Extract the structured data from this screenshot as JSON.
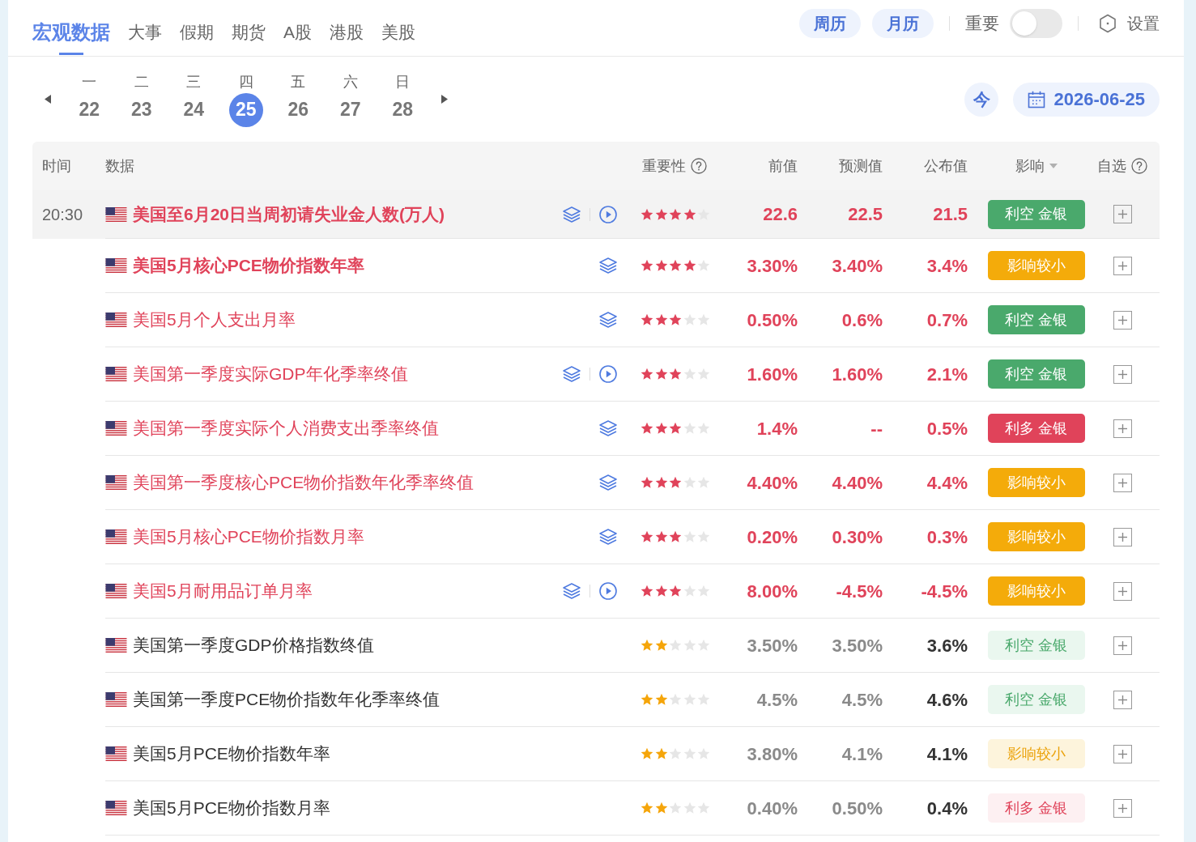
{
  "nav": {
    "tabs": [
      {
        "label": "宏观数据",
        "selected": true
      },
      {
        "label": "大事",
        "selected": false
      },
      {
        "label": "假期",
        "selected": false
      },
      {
        "label": "期货",
        "selected": false
      },
      {
        "label": "A股",
        "selected": false
      },
      {
        "label": "港股",
        "selected": false
      },
      {
        "label": "美股",
        "selected": false
      }
    ],
    "view_buttons": [
      "周历",
      "月历"
    ],
    "toggle": {
      "label": "重要",
      "on": false
    },
    "settings": "设置"
  },
  "week": {
    "days": [
      {
        "weekday": "一",
        "date": "22",
        "selected": false
      },
      {
        "weekday": "二",
        "date": "23",
        "selected": false
      },
      {
        "weekday": "三",
        "date": "24",
        "selected": false
      },
      {
        "weekday": "四",
        "date": "25",
        "selected": true
      },
      {
        "weekday": "五",
        "date": "26",
        "selected": false
      },
      {
        "weekday": "六",
        "date": "27",
        "selected": false
      },
      {
        "weekday": "日",
        "date": "28",
        "selected": false
      }
    ],
    "today_button": "今",
    "date_button": "2026-06-25"
  },
  "table": {
    "columns": [
      {
        "label": "时间",
        "kind": "plain"
      },
      {
        "label": "数据",
        "kind": "plain"
      },
      {
        "label": "重要性",
        "kind": "help"
      },
      {
        "label": "前值",
        "kind": "plain"
      },
      {
        "label": "预测值",
        "kind": "plain"
      },
      {
        "label": "公布值",
        "kind": "plain"
      },
      {
        "label": "影响",
        "kind": "dropdown"
      },
      {
        "label": "自选",
        "kind": "help"
      }
    ],
    "rows": [
      {
        "time": "20:30",
        "name": "美国至6月20日当周初请失业金人数(万人)",
        "kind": "chart_video",
        "bold": true,
        "important": true,
        "highlighted": true,
        "stars": 4,
        "previous": "22.6",
        "forecast": "22.5",
        "actual": "21.5",
        "impact": {
          "label": "利空 金银",
          "kind": "bearish"
        }
      },
      {
        "name": "美国5月核心PCE物价指数年率",
        "kind": "chart",
        "bold": true,
        "important": true,
        "highlighted": false,
        "stars": 4,
        "previous": "3.30%",
        "forecast": "3.40%",
        "actual": "3.4%",
        "impact": {
          "label": "影响较小",
          "kind": "minor"
        }
      },
      {
        "name": "美国5月个人支出月率",
        "kind": "chart",
        "bold": false,
        "important": true,
        "highlighted": false,
        "stars": 3,
        "previous": "0.50%",
        "forecast": "0.6%",
        "actual": "0.7%",
        "impact": {
          "label": "利空 金银",
          "kind": "bearish"
        }
      },
      {
        "name": "美国第一季度实际GDP年化季率终值",
        "kind": "chart_video",
        "bold": false,
        "important": true,
        "highlighted": false,
        "stars": 3,
        "previous": "1.60%",
        "forecast": "1.60%",
        "actual": "2.1%",
        "impact": {
          "label": "利空 金银",
          "kind": "bearish"
        }
      },
      {
        "name": "美国第一季度实际个人消费支出季率终值",
        "kind": "chart",
        "bold": false,
        "important": true,
        "highlighted": false,
        "stars": 3,
        "previous": "1.4%",
        "forecast": "--",
        "actual": "0.5%",
        "impact": {
          "label": "利多 金银",
          "kind": "bullish"
        }
      },
      {
        "name": "美国第一季度核心PCE物价指数年化季率终值",
        "kind": "chart",
        "bold": false,
        "important": true,
        "highlighted": false,
        "stars": 3,
        "previous": "4.40%",
        "forecast": "4.40%",
        "actual": "4.4%",
        "impact": {
          "label": "影响较小",
          "kind": "minor"
        }
      },
      {
        "name": "美国5月核心PCE物价指数月率",
        "kind": "chart",
        "bold": false,
        "important": true,
        "highlighted": false,
        "stars": 3,
        "previous": "0.20%",
        "forecast": "0.30%",
        "actual": "0.3%",
        "impact": {
          "label": "影响较小",
          "kind": "minor"
        }
      },
      {
        "name": "美国5月耐用品订单月率",
        "kind": "chart_video",
        "bold": false,
        "important": true,
        "highlighted": false,
        "stars": 3,
        "previous": "8.00%",
        "forecast": "-4.5%",
        "actual": "-4.5%",
        "impact": {
          "label": "影响较小",
          "kind": "minor"
        }
      },
      {
        "name": "美国第一季度GDP价格指数终值",
        "kind": "plain",
        "bold": false,
        "important": false,
        "highlighted": false,
        "stars": 2,
        "previous": "3.50%",
        "forecast": "3.50%",
        "actual": "3.6%",
        "impact": {
          "label": "利空 金银",
          "kind": "bearish"
        }
      },
      {
        "name": "美国第一季度PCE物价指数年化季率终值",
        "kind": "plain",
        "bold": false,
        "important": false,
        "highlighted": false,
        "stars": 2,
        "previous": "4.5%",
        "forecast": "4.5%",
        "actual": "4.6%",
        "impact": {
          "label": "利空 金银",
          "kind": "bearish"
        }
      },
      {
        "name": "美国5月PCE物价指数年率",
        "kind": "plain",
        "bold": false,
        "important": false,
        "highlighted": false,
        "stars": 2,
        "previous": "3.80%",
        "forecast": "4.1%",
        "actual": "4.1%",
        "impact": {
          "label": "影响较小",
          "kind": "minor"
        }
      },
      {
        "name": "美国5月PCE物价指数月率",
        "kind": "plain",
        "bold": false,
        "important": false,
        "highlighted": false,
        "stars": 2,
        "previous": "0.40%",
        "forecast": "0.50%",
        "actual": "0.4%",
        "impact": {
          "label": "利多 金银",
          "kind": "bullish"
        }
      }
    ]
  }
}
